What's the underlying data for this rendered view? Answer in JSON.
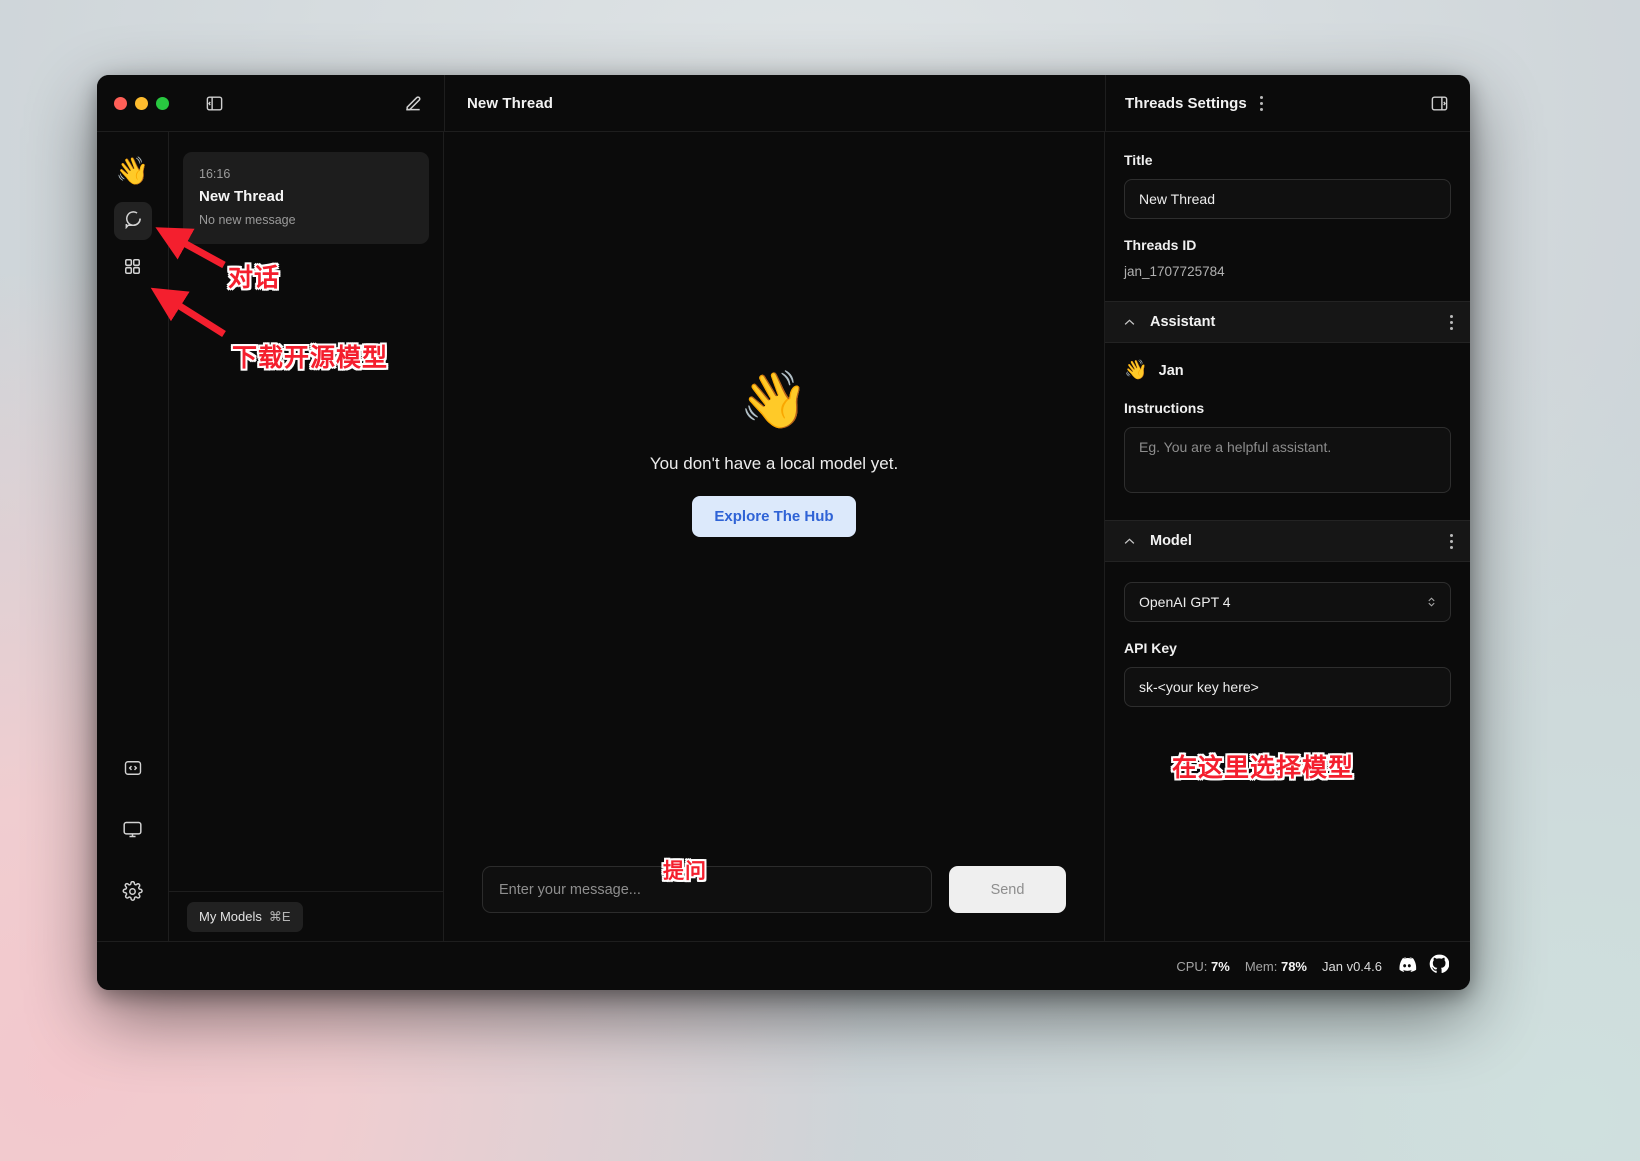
{
  "window": {
    "title_center": "New Thread",
    "traffic_lights": [
      "close",
      "minimize",
      "maximize"
    ]
  },
  "rail": {
    "logo_emoji": "👋",
    "items": [
      {
        "name": "chat",
        "icon": "chat-bubble-icon",
        "active": true
      },
      {
        "name": "hub",
        "icon": "grid-icon",
        "active": false
      }
    ],
    "bottom_items": [
      {
        "name": "local-api-server",
        "icon": "code-brackets-icon"
      },
      {
        "name": "system-monitor",
        "icon": "monitor-icon"
      },
      {
        "name": "settings",
        "icon": "gear-icon"
      }
    ]
  },
  "threads": {
    "new_thread_icon": "compose-icon",
    "panel_toggle_icon": "panel-left-icon",
    "list": [
      {
        "time": "16:16",
        "title": "New Thread",
        "subtitle": "No new message"
      }
    ],
    "my_models_label": "My Models",
    "my_models_shortcut": "⌘E"
  },
  "main": {
    "empty_emoji": "👋",
    "empty_message": "You don't have a local model yet.",
    "explore_button": "Explore The Hub",
    "input_placeholder": "Enter your message...",
    "input_value": "",
    "send_label": "Send"
  },
  "settings": {
    "header_title": "Threads Settings",
    "collapse_icon": "panel-right-icon",
    "menu_icon": "kebab-menu-icon",
    "title_label": "Title",
    "title_value": "New Thread",
    "threads_id_label": "Threads ID",
    "threads_id_value": "jan_1707725784",
    "assistant_section": "Assistant",
    "assistant_emoji": "👋",
    "assistant_name": "Jan",
    "instructions_label": "Instructions",
    "instructions_placeholder": "Eg. You are a helpful assistant.",
    "instructions_value": "",
    "model_section": "Model",
    "model_selected": "OpenAI GPT 4",
    "api_key_label": "API Key",
    "api_key_value": "sk-<your key here>"
  },
  "statusbar": {
    "cpu_label": "CPU:",
    "cpu_value": "7%",
    "mem_label": "Mem:",
    "mem_value": "78%",
    "version": "Jan v0.4.6",
    "social": [
      "discord-icon",
      "github-icon"
    ]
  },
  "annotations": {
    "chat": "对话",
    "download_models": "下载开源模型",
    "ask_question": "提问",
    "select_model_here": "在这里选择模型",
    "color": "#f41f2e"
  }
}
